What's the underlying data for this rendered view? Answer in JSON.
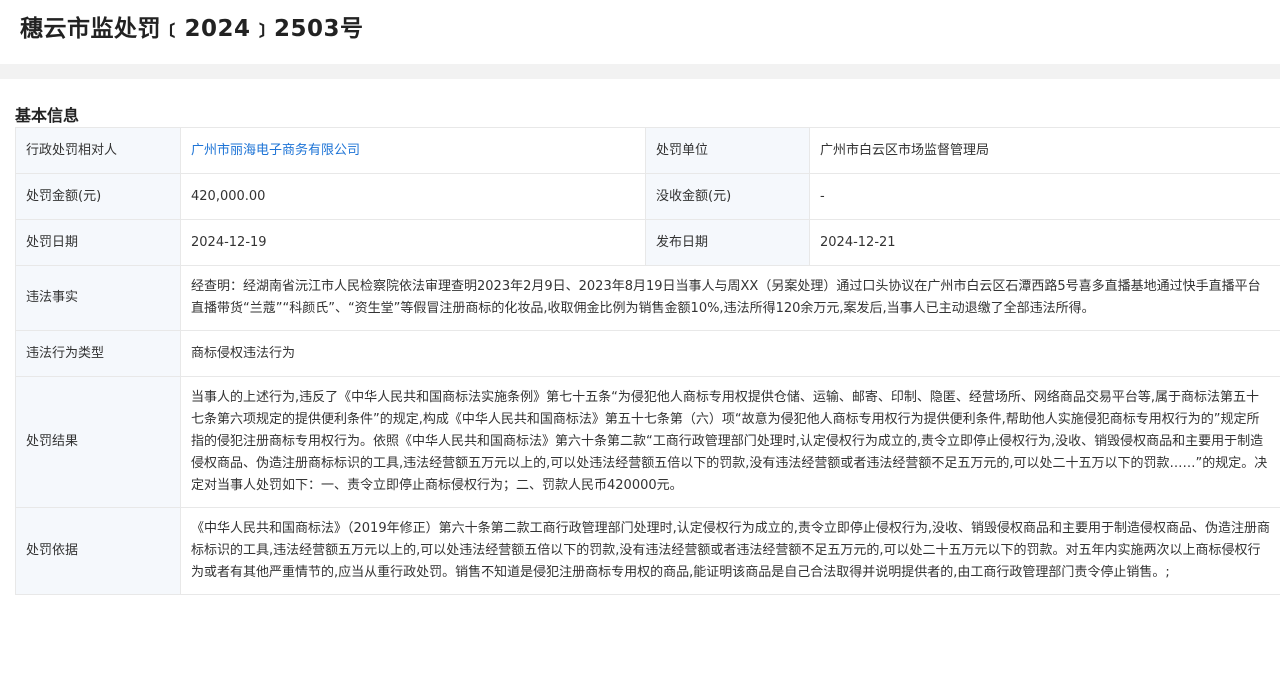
{
  "page": {
    "title": "穗云市监处罚﹝2024﹞2503号"
  },
  "section": {
    "title": "基本信息"
  },
  "info": {
    "party_label": "行政处罚相对人",
    "party_value": "广州市丽海电子商务有限公司",
    "unit_label": "处罚单位",
    "unit_value": "广州市白云区市场监督管理局",
    "amount_label": "处罚金额(元)",
    "amount_value": "420,000.00",
    "confiscate_label": "没收金额(元)",
    "confiscate_value": "-",
    "date_label": "处罚日期",
    "date_value": "2024-12-19",
    "publish_label": "发布日期",
    "publish_value": "2024-12-21",
    "facts_label": "违法事实",
    "facts_value": "经查明：经湖南省沅江市人民检察院依法审理查明2023年2月9日、2023年8月19日当事人与周XX（另案处理）通过口头协议在广州市白云区石潭西路5号喜多直播基地通过快手直播平台直播带货“兰蔻”“科颜氏”、“资生堂”等假冒注册商标的化妆品,收取佣金比例为销售金额10%,违法所得120余万元,案发后,当事人已主动退缴了全部违法所得。",
    "type_label": "违法行为类型",
    "type_value": "商标侵权违法行为",
    "result_label": "处罚结果",
    "result_value": "当事人的上述行为,违反了《中华人民共和国商标法实施条例》第七十五条“为侵犯他人商标专用权提供仓储、运输、邮寄、印制、隐匿、经营场所、网络商品交易平台等,属于商标法第五十七条第六项规定的提供便利条件”的规定,构成《中华人民共和国商标法》第五十七条第（六）项“故意为侵犯他人商标专用权行为提供便利条件,帮助他人实施侵犯商标专用权行为的”规定所指的侵犯注册商标专用权行为。依照《中华人民共和国商标法》第六十条第二款“工商行政管理部门处理时,认定侵权行为成立的,责令立即停止侵权行为,没收、销毁侵权商品和主要用于制造侵权商品、伪造注册商标标识的工具,违法经营额五万元以上的,可以处违法经营额五倍以下的罚款,没有违法经营额或者违法经营额不足五万元的,可以处二十五万以下的罚款……”的规定。决定对当事人处罚如下：一、责令立即停止商标侵权行为；二、罚款人民币420000元。",
    "basis_label": "处罚依据",
    "basis_value": "《中华人民共和国商标法》（2019年修正）第六十条第二款工商行政管理部门处理时,认定侵权行为成立的,责令立即停止侵权行为,没收、销毁侵权商品和主要用于制造侵权商品、伪造注册商标标识的工具,违法经营额五万元以上的,可以处违法经营额五倍以下的罚款,没有违法经营额或者违法经营额不足五万元的,可以处二十五万元以下的罚款。对五年内实施两次以上商标侵权行为或者有其他严重情节的,应当从重行政处罚。销售不知道是侵犯注册商标专用权的商品,能证明该商品是自己合法取得并说明提供者的,由工商行政管理部门责令停止销售。;"
  }
}
